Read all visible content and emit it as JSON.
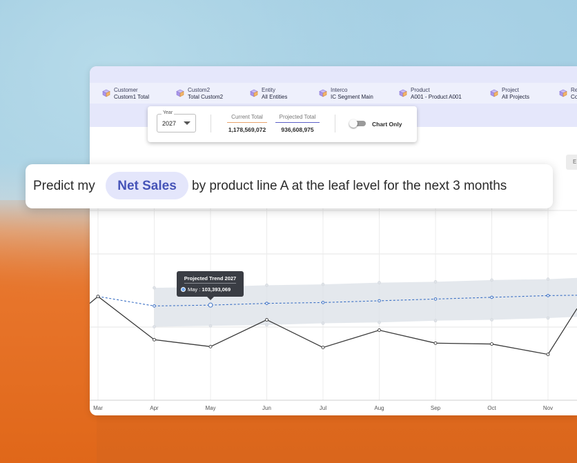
{
  "dimensions": [
    {
      "label": "Customer",
      "value": "Custom1 Total"
    },
    {
      "label": "Custom2",
      "value": "Total Custom2"
    },
    {
      "label": "Entity",
      "value": "All Entities"
    },
    {
      "label": "Interco",
      "value": "IC Segment Main"
    },
    {
      "label": "Product",
      "value": "A001 - Product A001"
    },
    {
      "label": "Project",
      "value": "All Projects"
    },
    {
      "label": "Re",
      "value": "Co"
    }
  ],
  "icons": {
    "dimension": "cube-icon",
    "dropdown": "chevron-down-icon"
  },
  "panel": {
    "year_label": "Year",
    "year_value": "2027",
    "current_label": "Current Total",
    "current_value": "1,178,569,072",
    "projected_label": "Projected Total",
    "projected_value": "936,608,975",
    "toggle_label": "Chart Only",
    "toggle_on": false
  },
  "toolbar": {
    "export_label": "E"
  },
  "prompt": {
    "before": "Predict my",
    "highlight": "Net Sales",
    "after": "by product line A at the leaf level for the next 3 months"
  },
  "tooltip": {
    "title": "Projected Trend 2027",
    "row": "May : ",
    "value": "103,393,069"
  },
  "colors": {
    "accent": "#4654b8",
    "pill_bg": "#e4e6fb",
    "current_underline": "#e8a36b",
    "projected_underline": "#5b5fc7",
    "actual_line": "#3a3a3a",
    "projected_line": "#3a6fc4",
    "band": "#dde2e8"
  },
  "chart_data": {
    "type": "line",
    "categories": [
      "Mar",
      "Apr",
      "May",
      "Jun",
      "Jul",
      "Aug",
      "Sep",
      "Oct",
      "Nov"
    ],
    "series": [
      {
        "values": [
          120,
          70,
          62,
          93,
          61,
          81,
          66,
          65,
          53
        ]
      },
      {
        "values": [
          120,
          109,
          110,
          112,
          113,
          115,
          117,
          119,
          121
        ]
      },
      {
        "values": [
          null,
          130,
          131,
          133,
          134,
          136,
          137,
          139,
          140
        ]
      },
      {
        "values": [
          null,
          85,
          86,
          87,
          89,
          90,
          92,
          93,
          95
        ]
      }
    ]
  }
}
